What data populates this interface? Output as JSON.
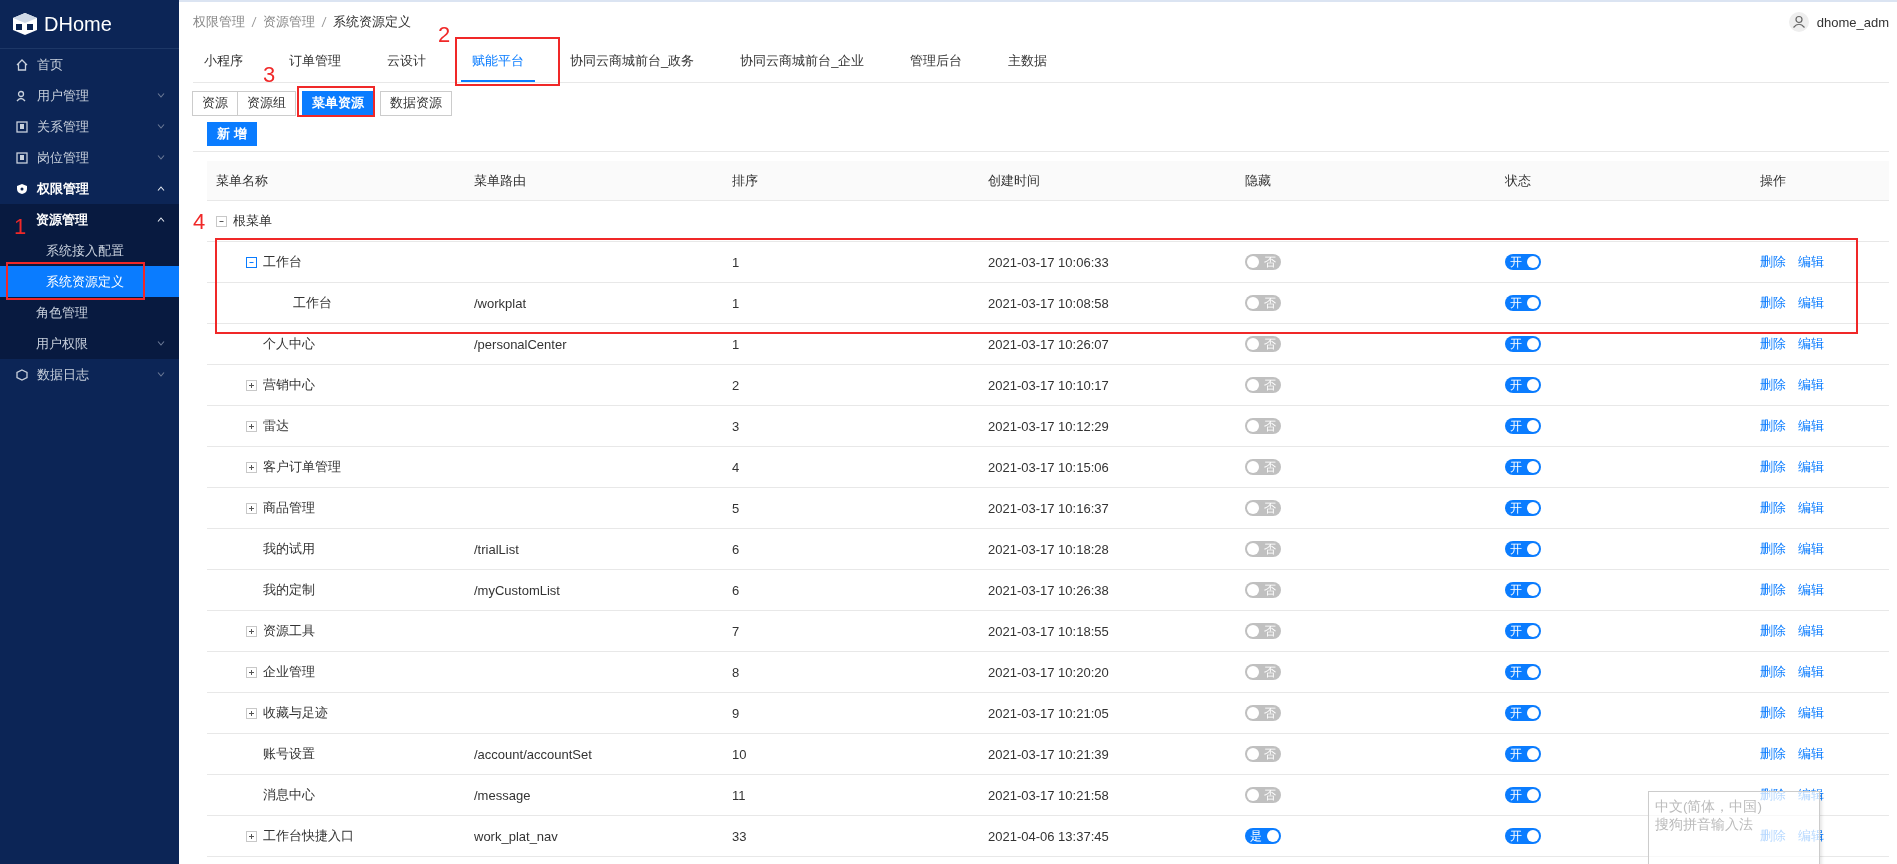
{
  "sidebar": {
    "logo": "DHome",
    "items": [
      {
        "label": "首页"
      },
      {
        "label": "用户管理",
        "expanded": false,
        "collapsible": true
      },
      {
        "label": "关系管理",
        "expanded": false,
        "collapsible": true
      },
      {
        "label": "岗位管理",
        "expanded": false,
        "collapsible": true
      },
      {
        "label": "权限管理",
        "expanded": true,
        "collapsible": true,
        "children": [
          {
            "label": "资源管理",
            "expanded": true,
            "collapsible": true,
            "selected": false,
            "children": [
              {
                "label": "系统接入配置",
                "selected": false
              },
              {
                "label": "系统资源定义",
                "selected": true
              }
            ]
          },
          {
            "label": "角色管理",
            "expanded": false,
            "collapsible": false,
            "selected": false
          },
          {
            "label": "用户权限",
            "expanded": false,
            "collapsible": true,
            "selected": false
          }
        ]
      },
      {
        "label": "数据日志",
        "expanded": false,
        "collapsible": true
      }
    ]
  },
  "breadcrumb": [
    "权限管理",
    "资源管理",
    "系统资源定义"
  ],
  "user": {
    "name": "dhome_adm"
  },
  "tabs": [
    {
      "label": "小程序",
      "selected": false
    },
    {
      "label": "订单管理",
      "selected": false
    },
    {
      "label": "云设计",
      "selected": false
    },
    {
      "label": "赋能平台",
      "selected": true
    },
    {
      "label": "协同云商城前台_政务",
      "selected": false
    },
    {
      "label": "协同云商城前台_企业",
      "selected": false
    },
    {
      "label": "管理后台",
      "selected": false
    },
    {
      "label": "主数据",
      "selected": false
    }
  ],
  "subtabs": [
    {
      "label": "资源",
      "selected": false
    },
    {
      "label": "资源组",
      "selected": false
    },
    {
      "label": "菜单资源",
      "selected": true
    },
    {
      "label": "数据资源",
      "selected": false
    }
  ],
  "add_button": "新 增",
  "table": {
    "columns": [
      "菜单名称",
      "菜单路由",
      "排序",
      "创建时间",
      "隐藏",
      "状态",
      "操作"
    ],
    "rows": [
      {
        "name": "根菜单",
        "expanded": true,
        "focused": false,
        "children": [
          {
            "name": "工作台",
            "expanded": true,
            "focused": true,
            "sort": "1",
            "created": "2021-03-17 10:06:33",
            "hidden": {
              "on": false,
              "label": "否"
            },
            "status": {
              "on": true,
              "label": "开"
            },
            "actions": [
              "删除",
              "编辑"
            ],
            "children": [
              {
                "name": "工作台",
                "route": "/workplat",
                "sort": "1",
                "created": "2021-03-17 10:08:58",
                "hidden": {
                  "on": false,
                  "label": "否"
                },
                "status": {
                  "on": true,
                  "label": "开"
                },
                "actions": [
                  "删除",
                  "编辑"
                ]
              }
            ]
          },
          {
            "name": "个人中心",
            "route": "/personalCenter",
            "sort": "1",
            "created": "2021-03-17 10:26:07",
            "hidden": {
              "on": false,
              "label": "否"
            },
            "status": {
              "on": true,
              "label": "开"
            },
            "actions": [
              "删除",
              "编辑"
            ]
          },
          {
            "name": "营销中心",
            "expanded": false,
            "focused": false,
            "sort": "2",
            "created": "2021-03-17 10:10:17",
            "hidden": {
              "on": false,
              "label": "否"
            },
            "status": {
              "on": true,
              "label": "开"
            },
            "actions": [
              "删除",
              "编辑"
            ]
          },
          {
            "name": "雷达",
            "expanded": false,
            "focused": false,
            "sort": "3",
            "created": "2021-03-17 10:12:29",
            "hidden": {
              "on": false,
              "label": "否"
            },
            "status": {
              "on": true,
              "label": "开"
            },
            "actions": [
              "删除",
              "编辑"
            ]
          },
          {
            "name": "客户订单管理",
            "expanded": false,
            "focused": false,
            "sort": "4",
            "created": "2021-03-17 10:15:06",
            "hidden": {
              "on": false,
              "label": "否"
            },
            "status": {
              "on": true,
              "label": "开"
            },
            "actions": [
              "删除",
              "编辑"
            ]
          },
          {
            "name": "商品管理",
            "expanded": false,
            "focused": false,
            "sort": "5",
            "created": "2021-03-17 10:16:37",
            "hidden": {
              "on": false,
              "label": "否"
            },
            "status": {
              "on": true,
              "label": "开"
            },
            "actions": [
              "删除",
              "编辑"
            ]
          },
          {
            "name": "我的试用",
            "route": "/trialList",
            "sort": "6",
            "created": "2021-03-17 10:18:28",
            "hidden": {
              "on": false,
              "label": "否"
            },
            "status": {
              "on": true,
              "label": "开"
            },
            "actions": [
              "删除",
              "编辑"
            ]
          },
          {
            "name": "我的定制",
            "route": "/myCustomList",
            "sort": "6",
            "created": "2021-03-17 10:26:38",
            "hidden": {
              "on": false,
              "label": "否"
            },
            "status": {
              "on": true,
              "label": "开"
            },
            "actions": [
              "删除",
              "编辑"
            ]
          },
          {
            "name": "资源工具",
            "expanded": false,
            "focused": false,
            "sort": "7",
            "created": "2021-03-17 10:18:55",
            "hidden": {
              "on": false,
              "label": "否"
            },
            "status": {
              "on": true,
              "label": "开"
            },
            "actions": [
              "删除",
              "编辑"
            ]
          },
          {
            "name": "企业管理",
            "expanded": false,
            "focused": false,
            "sort": "8",
            "created": "2021-03-17 10:20:20",
            "hidden": {
              "on": false,
              "label": "否"
            },
            "status": {
              "on": true,
              "label": "开"
            },
            "actions": [
              "删除",
              "编辑"
            ]
          },
          {
            "name": "收藏与足迹",
            "expanded": false,
            "focused": false,
            "sort": "9",
            "created": "2021-03-17 10:21:05",
            "hidden": {
              "on": false,
              "label": "否"
            },
            "status": {
              "on": true,
              "label": "开"
            },
            "actions": [
              "删除",
              "编辑"
            ]
          },
          {
            "name": "账号设置",
            "route": "/account/accountSet",
            "sort": "10",
            "created": "2021-03-17 10:21:39",
            "hidden": {
              "on": false,
              "label": "否"
            },
            "status": {
              "on": true,
              "label": "开"
            },
            "actions": [
              "删除",
              "编辑"
            ]
          },
          {
            "name": "消息中心",
            "route": "/message",
            "sort": "11",
            "created": "2021-03-17 10:21:58",
            "hidden": {
              "on": false,
              "label": "否"
            },
            "status": {
              "on": true,
              "label": "开"
            },
            "actions": [
              "删除",
              "编辑"
            ]
          },
          {
            "name": "工作台快捷入口",
            "expanded": false,
            "focused": false,
            "route": "work_plat_nav",
            "sort": "33",
            "created": "2021-04-06 13:37:45",
            "hidden": {
              "on": true,
              "label": "是"
            },
            "status": {
              "on": true,
              "label": "开"
            },
            "actions": [
              "删除",
              "编辑"
            ]
          }
        ]
      }
    ]
  },
  "annotations": [
    {
      "label": "1"
    },
    {
      "label": "2"
    },
    {
      "label": "3"
    },
    {
      "label": "4"
    }
  ],
  "ime_popup": {
    "lines": [
      "中文(简体，中国)",
      "搜狗拼音输入法"
    ]
  }
}
